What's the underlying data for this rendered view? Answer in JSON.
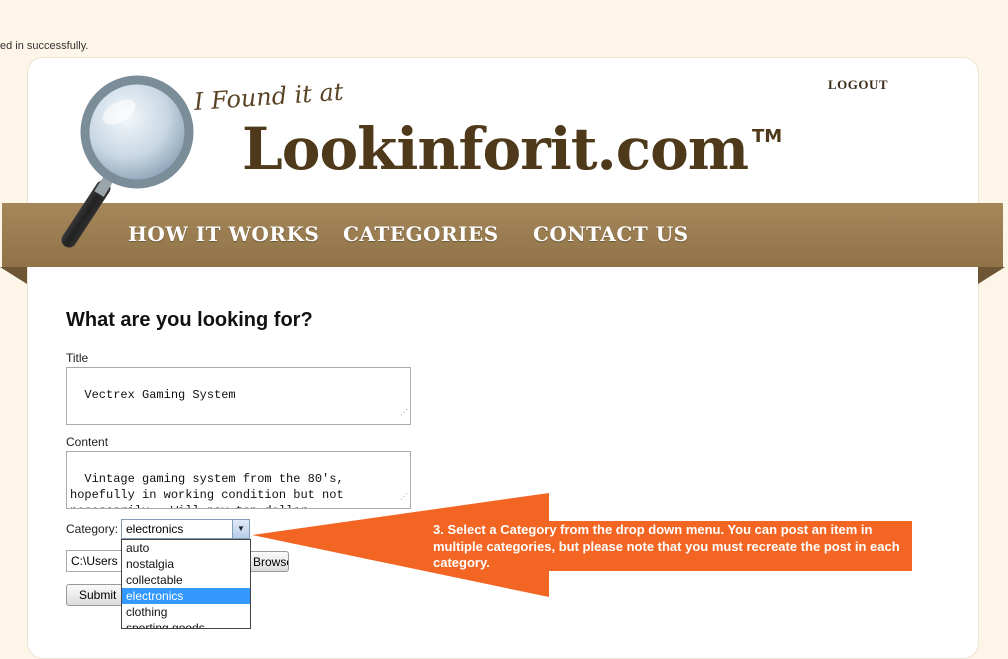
{
  "flash": {
    "message": "ed in successfully."
  },
  "header": {
    "logout_label": "LOGOUT",
    "tagline": "I Found it at",
    "brand": "Lookinforit.com",
    "trademark": "TM",
    "logo_icon": "magnifying-glass"
  },
  "nav": {
    "items": [
      {
        "label": "HOW IT WORKS"
      },
      {
        "label": "CATEGORIES"
      },
      {
        "label": "CONTACT US"
      }
    ]
  },
  "form": {
    "heading": "What are you looking for?",
    "title_label": "Title",
    "title_value": "Vectrex Gaming System",
    "content_label": "Content",
    "content_value": "Vintage gaming system from the 80's,\nhopefully in working condition but not\nnecessarily.  Will pay top dollar",
    "category_label": "Category:",
    "category_selected": "electronics",
    "category_options": [
      "auto",
      "nostalgia",
      "collectable",
      "electronics",
      "clothing",
      "sporting goods"
    ],
    "file_value": "C:\\Users",
    "browse_label": "Browse...",
    "submit_label": "Submit"
  },
  "callout": {
    "text": "3.  Select a Category from the drop down menu.  You can post an item in multiple categories, but please note that you must recreate the post in each category.",
    "color": "#f26522"
  },
  "colors": {
    "background": "#fdf6e8",
    "nav": "#9b7f52",
    "brand": "#4e3a1a",
    "highlight": "#3399ff"
  }
}
